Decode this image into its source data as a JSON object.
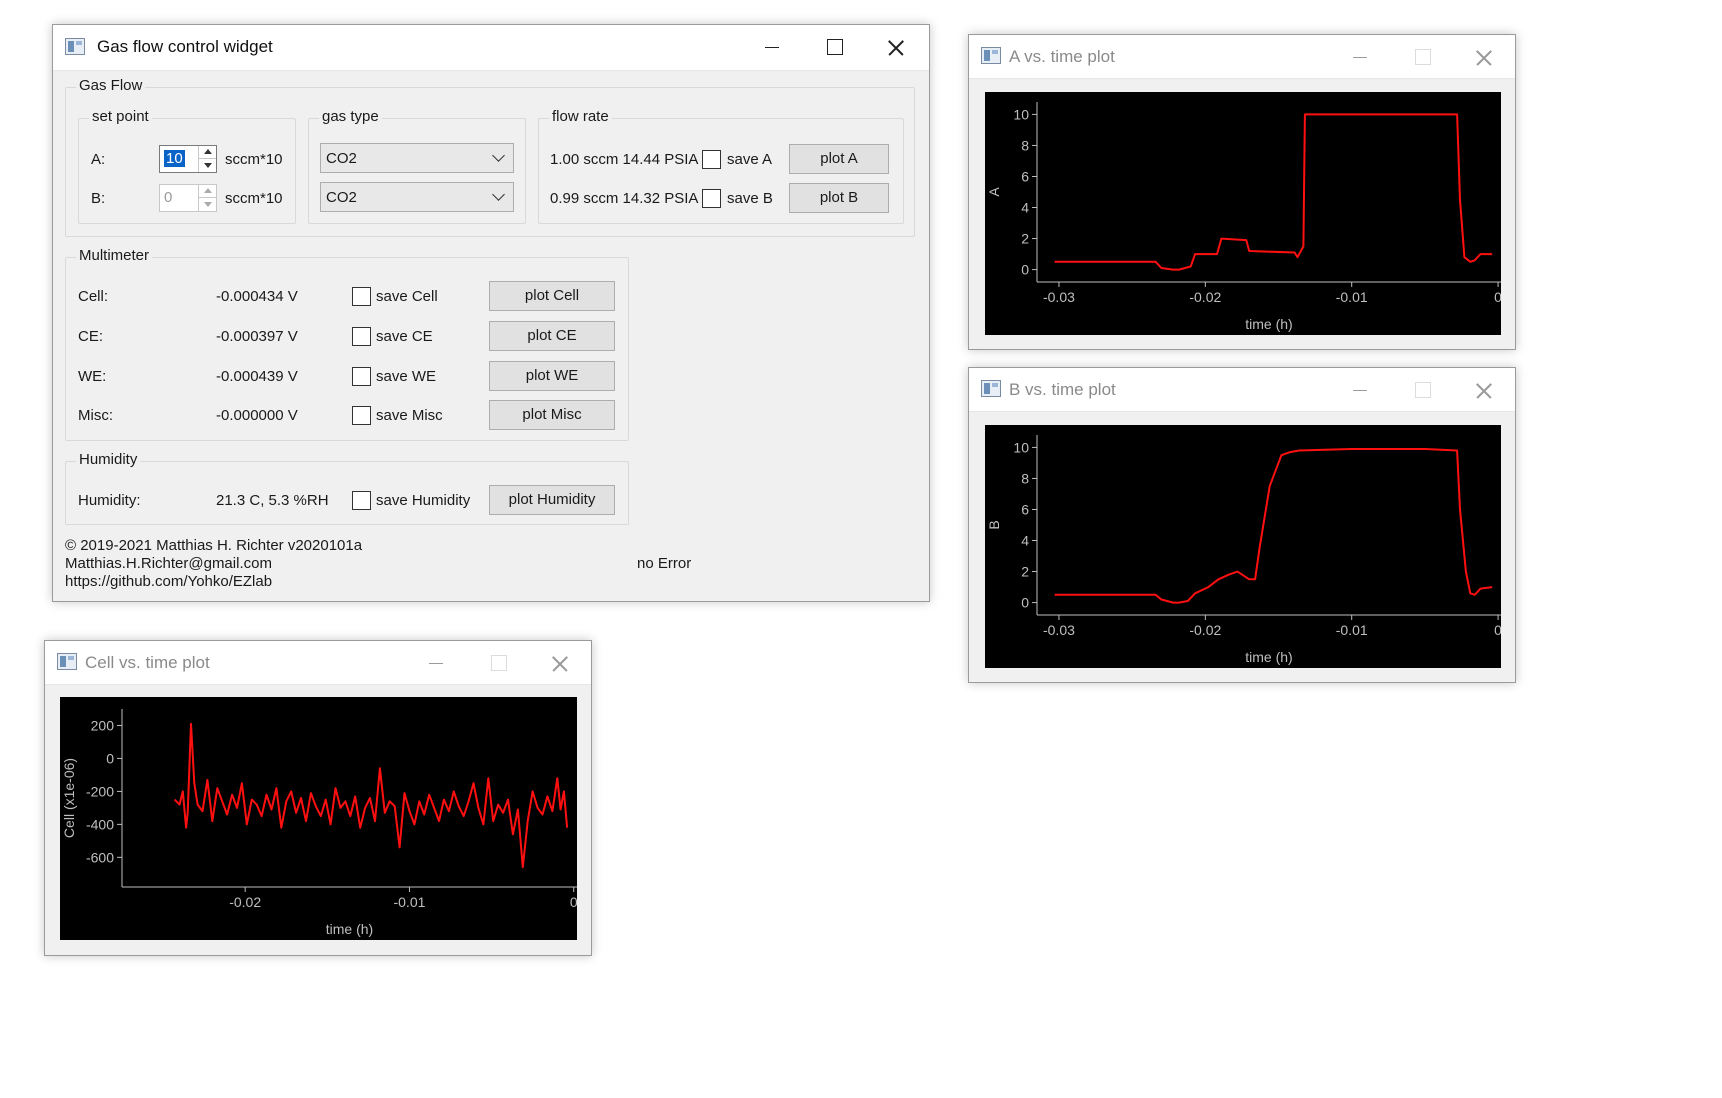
{
  "main": {
    "title": "Gas flow control widget",
    "gas_flow": {
      "title": "Gas Flow",
      "set_point": {
        "title": "set point",
        "a_label": "A:",
        "a_value": "10",
        "b_label": "B:",
        "b_value": "0",
        "unit": "sccm*10"
      },
      "gas_type": {
        "title": "gas type",
        "a_value": "CO2",
        "b_value": "CO2"
      },
      "flow_rate": {
        "title": "flow rate",
        "a_value": "1.00 sccm 14.44 PSIA",
        "b_value": "0.99 sccm 14.32 PSIA",
        "save_a": "save A",
        "save_b": "save B",
        "plot_a": "plot A",
        "plot_b": "plot B"
      }
    },
    "multimeter": {
      "title": "Multimeter",
      "rows": [
        {
          "label": "Cell:",
          "value": "-0.000434 V",
          "save": "save Cell",
          "plot": "plot Cell"
        },
        {
          "label": "CE:",
          "value": "-0.000397 V",
          "save": "save CE",
          "plot": "plot CE"
        },
        {
          "label": "WE:",
          "value": "-0.000439 V",
          "save": "save WE",
          "plot": "plot WE"
        },
        {
          "label": "Misc:",
          "value": "-0.000000 V",
          "save": "save Misc",
          "plot": "plot Misc"
        }
      ]
    },
    "humidity": {
      "title": "Humidity",
      "label": "Humidity:",
      "value": "21.3 C, 5.3 %RH",
      "save": "save Humidity",
      "plot": "plot Humidity"
    },
    "footer": {
      "copyright": "© 2019-2021 Matthias H. Richter v2020101a",
      "email": "Matthias.H.Richter@gmail.com",
      "url": "https://github.com/Yohko/EZlab",
      "status": "no Error"
    }
  },
  "plot_windows": {
    "a": {
      "title": "A vs. time plot"
    },
    "b": {
      "title": "B vs. time plot"
    },
    "cell": {
      "title": "Cell vs. time plot"
    }
  },
  "colors": {
    "trace": "#ff1010",
    "axis": "#bfbfbf",
    "plot_bg": "#000000"
  },
  "chart_data": [
    {
      "id": "a",
      "type": "line",
      "xlabel": "time (h)",
      "ylabel": "A",
      "xlim": [
        -0.0315,
        0.0002
      ],
      "ylim": [
        -0.8,
        10.8
      ],
      "xticks": [
        -0.03,
        -0.02,
        -0.01,
        0
      ],
      "xtick_labels": [
        "-0.03",
        "-0.02",
        "-0.01",
        "0"
      ],
      "yticks": [
        0,
        2,
        4,
        6,
        8,
        10
      ],
      "ytick_labels": [
        "0",
        "2",
        "4",
        "6",
        "8",
        "10"
      ],
      "series": [
        {
          "x": [
            -0.0303,
            -0.0234,
            -0.023,
            -0.0222,
            -0.0218,
            -0.021,
            -0.0207,
            -0.0192,
            -0.0189,
            -0.0172,
            -0.017,
            -0.0139,
            -0.0137,
            -0.0133,
            -0.0132,
            -0.0028,
            -0.0026,
            -0.0023,
            -0.0019,
            -0.0016,
            -0.0012,
            -0.0004
          ],
          "y": [
            0.5,
            0.5,
            0.1,
            0,
            0,
            0.2,
            1.0,
            1.0,
            2.0,
            1.9,
            1.2,
            1.1,
            0.8,
            1.5,
            10.0,
            10.0,
            4.5,
            0.8,
            0.5,
            0.6,
            1.0,
            1.0
          ]
        }
      ]
    },
    {
      "id": "b",
      "type": "line",
      "xlabel": "time (h)",
      "ylabel": "B",
      "xlim": [
        -0.0315,
        0.0002
      ],
      "ylim": [
        -0.8,
        10.8
      ],
      "xticks": [
        -0.03,
        -0.02,
        -0.01,
        0
      ],
      "xtick_labels": [
        "-0.03",
        "-0.02",
        "-0.01",
        "0"
      ],
      "yticks": [
        0,
        2,
        4,
        6,
        8,
        10
      ],
      "ytick_labels": [
        "0",
        "2",
        "4",
        "6",
        "8",
        "10"
      ],
      "series": [
        {
          "x": [
            -0.0303,
            -0.0234,
            -0.023,
            -0.0222,
            -0.0218,
            -0.0212,
            -0.0207,
            -0.0198,
            -0.0191,
            -0.0184,
            -0.0178,
            -0.017,
            -0.0166,
            -0.0163,
            -0.0156,
            -0.0148,
            -0.0142,
            -0.0136,
            -0.01,
            -0.005,
            -0.0028,
            -0.0026,
            -0.0022,
            -0.0019,
            -0.0016,
            -0.0012,
            -0.0004
          ],
          "y": [
            0.5,
            0.5,
            0.2,
            0,
            0,
            0.1,
            0.6,
            1.0,
            1.5,
            1.8,
            2.0,
            1.5,
            1.5,
            3.5,
            7.5,
            9.5,
            9.7,
            9.8,
            9.9,
            9.9,
            9.8,
            6.0,
            2.0,
            0.6,
            0.5,
            0.9,
            1.0
          ]
        }
      ]
    },
    {
      "id": "cell",
      "type": "line",
      "xlabel": "time (h)",
      "ylabel": "Cell (x1e-06)",
      "xlim": [
        -0.0275,
        0.0002
      ],
      "ylim": [
        -780,
        300
      ],
      "xticks": [
        -0.02,
        -0.01,
        0
      ],
      "xtick_labels": [
        "-0.02",
        "-0.01",
        "0"
      ],
      "yticks": [
        200,
        0,
        -200,
        -400,
        -600
      ],
      "ytick_labels": [
        "200",
        "0",
        "-200",
        "-400",
        "-600"
      ],
      "series": [
        {
          "x": [
            -0.0243,
            -0.024,
            -0.0238,
            -0.0236,
            -0.0235,
            -0.0233,
            -0.0231,
            -0.0229,
            -0.0226,
            -0.0223,
            -0.022,
            -0.0217,
            -0.0214,
            -0.0211,
            -0.0208,
            -0.0205,
            -0.0202,
            -0.0199,
            -0.0196,
            -0.0193,
            -0.019,
            -0.0187,
            -0.0184,
            -0.0181,
            -0.0178,
            -0.0175,
            -0.0172,
            -0.0169,
            -0.0166,
            -0.0163,
            -0.016,
            -0.0157,
            -0.0154,
            -0.0151,
            -0.0148,
            -0.0145,
            -0.0142,
            -0.0139,
            -0.0136,
            -0.0133,
            -0.013,
            -0.0127,
            -0.0124,
            -0.0121,
            -0.0118,
            -0.0115,
            -0.0112,
            -0.0109,
            -0.0106,
            -0.0103,
            -0.01,
            -0.0097,
            -0.0094,
            -0.0091,
            -0.0088,
            -0.0085,
            -0.0082,
            -0.0079,
            -0.0076,
            -0.0073,
            -0.007,
            -0.0067,
            -0.0064,
            -0.0061,
            -0.0058,
            -0.0055,
            -0.0052,
            -0.0049,
            -0.0046,
            -0.0043,
            -0.004,
            -0.0037,
            -0.0034,
            -0.0031,
            -0.0028,
            -0.0025,
            -0.0022,
            -0.0019,
            -0.0016,
            -0.0013,
            -0.001,
            -0.0008,
            -0.0006,
            -0.0004
          ],
          "y": [
            -250,
            -280,
            -200,
            -420,
            -330,
            210,
            -150,
            -280,
            -320,
            -130,
            -380,
            -180,
            -260,
            -340,
            -220,
            -300,
            -150,
            -400,
            -250,
            -280,
            -350,
            -220,
            -310,
            -180,
            -420,
            -260,
            -200,
            -330,
            -240,
            -380,
            -210,
            -290,
            -350,
            -250,
            -400,
            -180,
            -300,
            -260,
            -350,
            -230,
            -420,
            -300,
            -240,
            -380,
            -60,
            -330,
            -260,
            -290,
            -540,
            -210,
            -320,
            -400,
            -260,
            -340,
            -220,
            -300,
            -380,
            -250,
            -320,
            -200,
            -290,
            -350,
            -260,
            -150,
            -300,
            -400,
            -120,
            -380,
            -280,
            -330,
            -250,
            -460,
            -310,
            -660,
            -380,
            -200,
            -300,
            -340,
            -230,
            -320,
            -120,
            -310,
            -200,
            -420
          ]
        }
      ]
    }
  ]
}
